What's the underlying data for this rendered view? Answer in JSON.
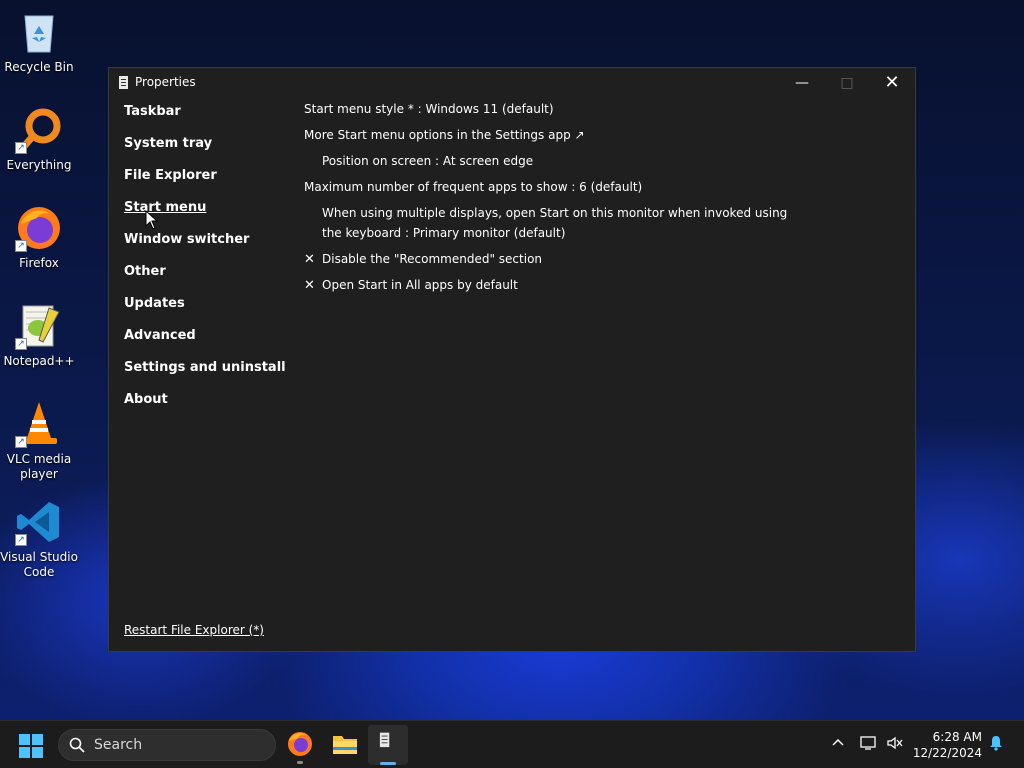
{
  "desktop": {
    "icons": [
      {
        "label": "Recycle Bin",
        "icon": "recycle-bin-icon"
      },
      {
        "label": "Everything",
        "icon": "everything-search-icon"
      },
      {
        "label": "Firefox",
        "icon": "firefox-icon"
      },
      {
        "label": "Notepad++",
        "icon": "notepad-plus-plus-icon"
      },
      {
        "label": "VLC media player",
        "icon": "vlc-icon"
      },
      {
        "label": "Visual Studio Code",
        "icon": "vscode-icon"
      }
    ]
  },
  "window": {
    "title": "Properties",
    "controls": {
      "minimize": "—",
      "maximize": "□",
      "close": "✕"
    },
    "sidebar": {
      "items": [
        "Taskbar",
        "System tray",
        "File Explorer",
        "Start menu",
        "Window switcher",
        "Other",
        "Updates",
        "Advanced",
        "Settings and uninstall",
        "About"
      ],
      "active": "Start menu"
    },
    "restart_link": "Restart File Explorer (*)",
    "settings": {
      "start_menu_style": "Start menu style * : Windows 11 (default)",
      "more_options": "More Start menu options in the Settings app ↗",
      "position": "Position on screen : At screen edge",
      "max_frequent": "Maximum number of frequent apps to show : 6 (default)",
      "multi_display_line1": "When using multiple displays, open Start on this monitor when invoked using",
      "multi_display_line2": "the keyboard : Primary monitor (default)",
      "disable_recommended": "Disable the \"Recommended\" section",
      "open_all_apps": "Open Start in All apps by default",
      "x_mark": "✕"
    }
  },
  "taskbar": {
    "search_placeholder": "Search",
    "time": "6:28 AM",
    "date": "12/22/2024",
    "tray_chevron": "^"
  },
  "colors": {
    "window_bg": "#1f1f1f",
    "taskbar_bg": "#1c1c1c",
    "accent": "#5fb2f2"
  }
}
